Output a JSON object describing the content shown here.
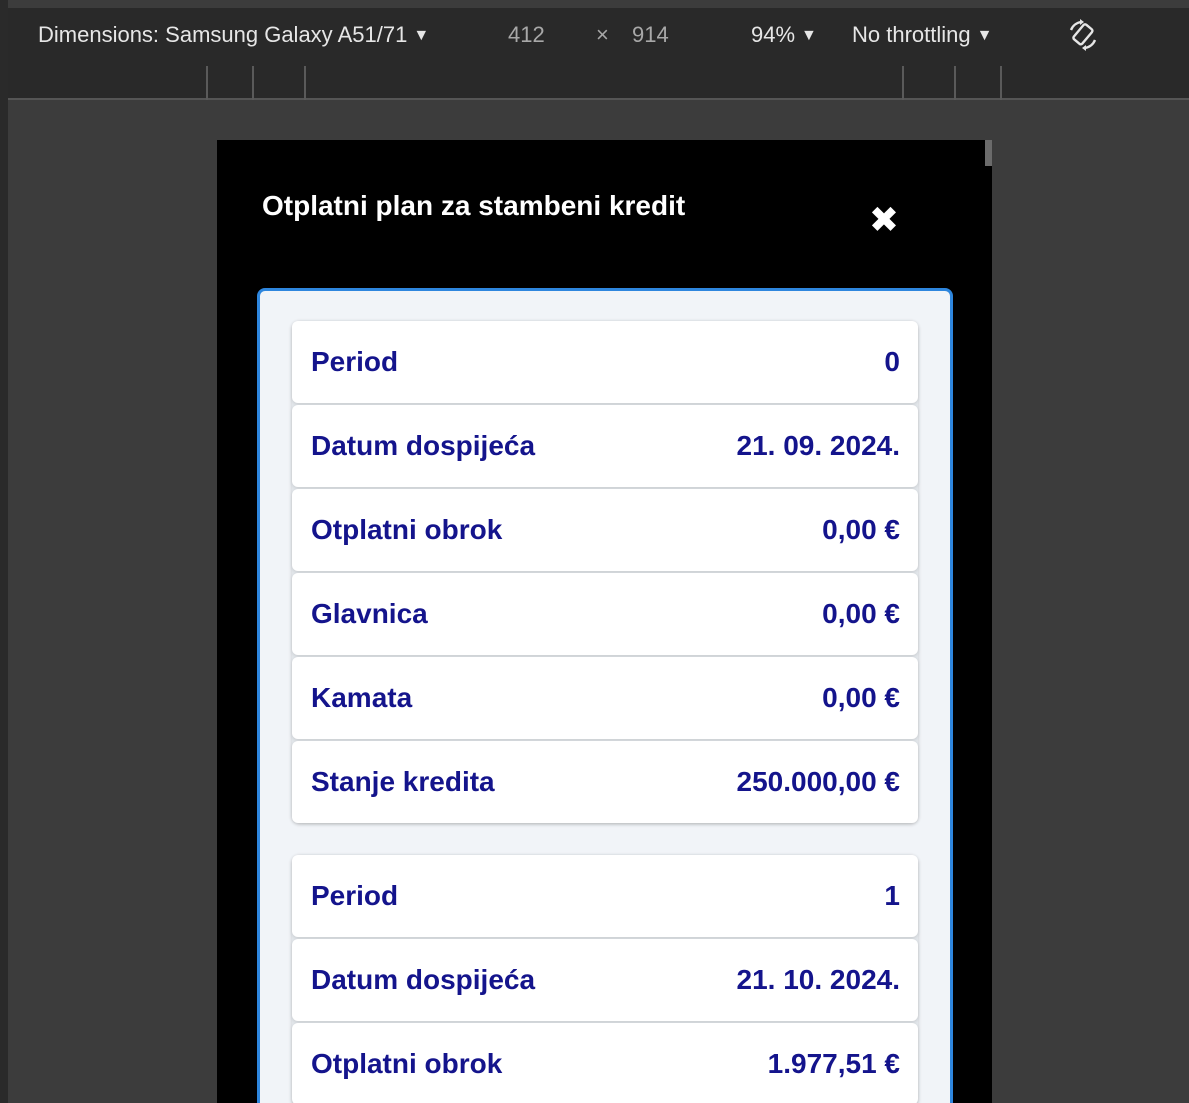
{
  "devtools": {
    "dimensions_label": "Dimensions: Samsung Galaxy A51/71",
    "width": "412",
    "times": "×",
    "height": "914",
    "zoom": "94%",
    "throttling": "No throttling",
    "caret": "▼",
    "icons": {
      "rotate": "rotate-icon"
    }
  },
  "modal": {
    "title": "Otplatni plan za stambeni kredit",
    "close_glyph": "✖",
    "periods": [
      {
        "rows": [
          {
            "label": "Period",
            "value": "0"
          },
          {
            "label": "Datum dospijeća",
            "value": "21. 09. 2024."
          },
          {
            "label": "Otplatni obrok",
            "value": "0,00 €"
          },
          {
            "label": "Glavnica",
            "value": "0,00 €"
          },
          {
            "label": "Kamata",
            "value": "0,00 €"
          },
          {
            "label": "Stanje kredita",
            "value": "250.000,00 €"
          }
        ]
      },
      {
        "rows": [
          {
            "label": "Period",
            "value": "1"
          },
          {
            "label": "Datum dospijeća",
            "value": "21. 10. 2024."
          },
          {
            "label": "Otplatni obrok",
            "value": "1.977,51 €"
          }
        ]
      }
    ]
  },
  "colors": {
    "label_text": "#14148c",
    "panel_border": "#2e86de",
    "panel_bg": "#f1f4f8"
  }
}
